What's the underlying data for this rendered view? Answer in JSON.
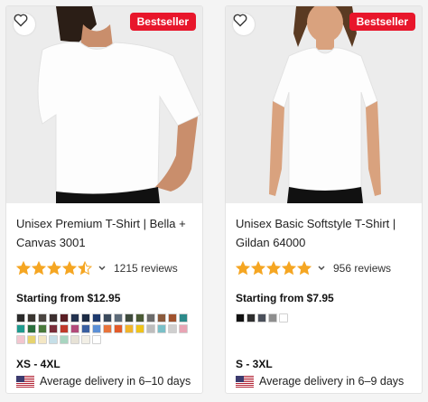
{
  "products": [
    {
      "name": "Unisex Premium T-Shirt | Bella + Canvas 3001",
      "name_line1": "Unisex Premium T-Shirt | Bella +",
      "name_line2": "Canvas 3001",
      "badge": "Bestseller",
      "rating": 4.5,
      "reviews": "1215 reviews",
      "price": "Starting from $12.95",
      "sizes": "XS - 4XL",
      "delivery": "Average delivery in 6–10 days",
      "colors": [
        "#2b2b2b",
        "#3a3530",
        "#4a4440",
        "#3c2f2f",
        "#5a1e24",
        "#23324f",
        "#1c2b44",
        "#1e3a6e",
        "#3b4a5c",
        "#5d6b79",
        "#3e4a3c",
        "#4a5a34",
        "#6b6b6b",
        "#8a5a3c",
        "#a0522d",
        "#2d8a8a",
        "#1f9b8f",
        "#2a6e3d",
        "#4a7a3c",
        "#7a2e3a",
        "#c0392b",
        "#b24a7a",
        "#3a5fa0",
        "#5b8fd6",
        "#e8743b",
        "#e35b2a",
        "#f1b52b",
        "#f0c419",
        "#bdbdbd",
        "#7ac0c8",
        "#cfcfcf",
        "#e8a4b4",
        "#f2c6cf",
        "#e6d36f",
        "#f4e7c4",
        "#c6dfe8",
        "#a8d5c0",
        "#e7e2d6",
        "#f2efe6",
        "#ffffff"
      ]
    },
    {
      "name": "Unisex Basic Softstyle T-Shirt | Gildan 64000",
      "name_line1": "Unisex Basic Softstyle T-Shirt |",
      "name_line2": "Gildan 64000",
      "badge": "Bestseller",
      "rating": 5,
      "reviews": "956 reviews",
      "price": "Starting from $7.95",
      "sizes": "S - 3XL",
      "delivery": "Average delivery in 6–9 days",
      "colors": [
        "#111111",
        "#2e2e2e",
        "#4a4f5a",
        "#8e8e8e",
        "#ffffff"
      ]
    }
  ],
  "icons": {
    "favorite": "heart-outline-icon",
    "star": "star-icon",
    "expand": "chevron-down-icon",
    "flag": "us-flag-icon"
  },
  "theme": {
    "badge": "#e8162b",
    "star": "#f5a623"
  }
}
